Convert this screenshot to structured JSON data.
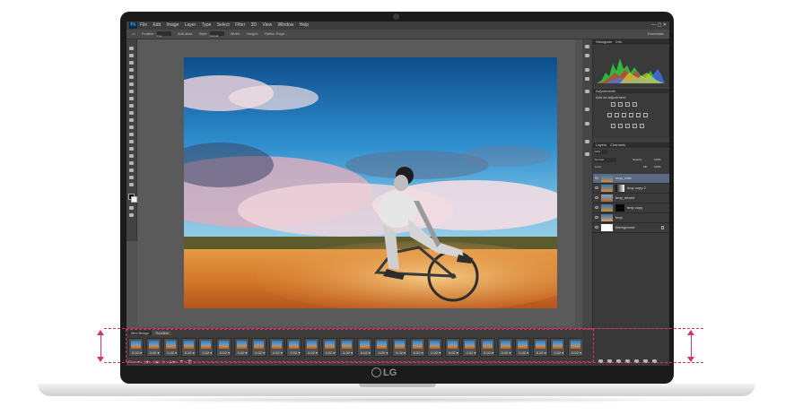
{
  "menubar": {
    "app_logo": "Ps",
    "menus": [
      "File",
      "Edit",
      "Image",
      "Layer",
      "Type",
      "Select",
      "Filter",
      "3D",
      "View",
      "Window",
      "Help"
    ],
    "window_controls": "—  ▢  ✕"
  },
  "options_bar": {
    "feather_label": "Feather:",
    "feather_value": "0 px",
    "antialias_label": "Anti-alias",
    "style_label": "Style:",
    "style_value": "Normal",
    "width_label": "Width:",
    "height_label": "Height:",
    "refine_label": "Refine Edge...",
    "workspace_value": "Essentials"
  },
  "panels": {
    "histogram_tabs": [
      "Histogram",
      "Info"
    ],
    "adjustments_tab": "Adjustments",
    "adjustments_title": "Add an adjustment",
    "layers_tabs": [
      "Layers",
      "Channels"
    ],
    "kind_label": "Kind",
    "blend_mode": "Normal",
    "opacity_label": "Opacity:",
    "opacity_value": "100%",
    "lock_label": "Lock:",
    "fill_label": "Fill:",
    "fill_value": "100%",
    "layers": [
      {
        "name": "bmp_rider",
        "selected": true,
        "mask": false
      },
      {
        "name": "bmp copy 2",
        "selected": false,
        "mask": true
      },
      {
        "name": "bmp_desert",
        "selected": false,
        "mask": false
      },
      {
        "name": "bmp copy",
        "selected": false,
        "mask": true
      },
      {
        "name": "bmp",
        "selected": false,
        "mask": false
      },
      {
        "name": "Background",
        "selected": false,
        "mask": false
      }
    ]
  },
  "timeline": {
    "tabs": [
      "Mini Bridge",
      "Timeline"
    ],
    "frame_delay": "0.02 ▾",
    "frame_count": 26,
    "loop_label": "Once ▾",
    "controls": [
      "|◀",
      "◀◀",
      "▶",
      "▶▶",
      "⧉",
      "🗑"
    ]
  },
  "brand": {
    "logo_text": "LG"
  },
  "colors": {
    "accent_pink": "#d6326b",
    "selected_layer": "#5b6a80",
    "ps_blue": "#31a8ff"
  }
}
